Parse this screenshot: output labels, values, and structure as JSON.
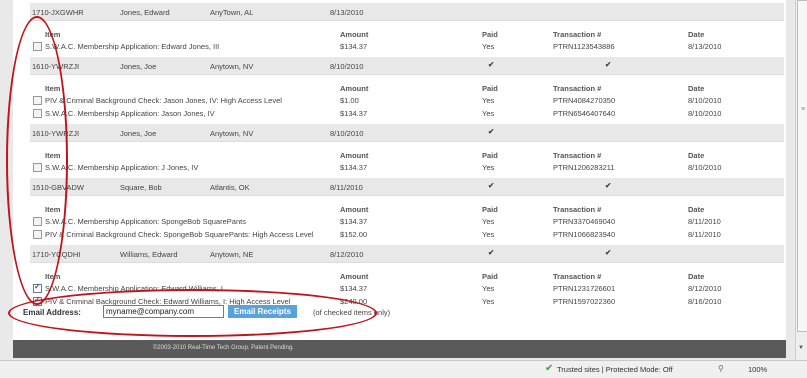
{
  "groups": [
    {
      "id": "1710-JXGWHR",
      "name": "Jones, Edward",
      "location": "AnyTown, AL",
      "date": "8/13/2010",
      "paid_check": "",
      "txn_check": "",
      "header": {
        "item": "Item",
        "amount": "Amount",
        "paid": "Paid",
        "transaction": "Transaction #",
        "date": "Date"
      },
      "items": [
        {
          "item": "S.W.A.C. Membership Application: Edward Jones, III",
          "amount": "$134.37",
          "paid": "Yes",
          "transaction": "PTRN1123543886",
          "date": "8/13/2010",
          "checked": false
        }
      ]
    },
    {
      "id": "1610-YWRZJI",
      "name": "Jones, Joe",
      "location": "Anytown, NV",
      "date": "8/10/2010",
      "paid_check": "✔",
      "txn_check": "✔",
      "header": {
        "item": "Item",
        "amount": "Amount",
        "paid": "Paid",
        "transaction": "Transaction #",
        "date": "Date"
      },
      "items": [
        {
          "item": "PIV & Criminal Background Check: Jason Jones, IV: High Access Level",
          "amount": "$1.00",
          "paid": "Yes",
          "transaction": "PTRN4084270350",
          "date": "8/10/2010",
          "checked": false
        },
        {
          "item": "S.W.A.C. Membership Application: Jason Jones, IV",
          "amount": "$134.37",
          "paid": "Yes",
          "transaction": "PTRN6546407640",
          "date": "8/10/2010",
          "checked": false
        }
      ]
    },
    {
      "id": "1610-YWRZJI",
      "name": "Jones, Joe",
      "location": "Anytown, NV",
      "date": "8/10/2010",
      "paid_check": "✔",
      "txn_check": "",
      "header": {
        "item": "Item",
        "amount": "Amount",
        "paid": "Paid",
        "transaction": "Transaction #",
        "date": "Date"
      },
      "items": [
        {
          "item": "S.W.A.C. Membership Application: J Jones, IV",
          "amount": "$134.37",
          "paid": "Yes",
          "transaction": "PTRN1206283211",
          "date": "8/10/2010",
          "checked": false
        }
      ]
    },
    {
      "id": "1510-GBVADW",
      "name": "Square, Bob",
      "location": "Atlantis, OK",
      "date": "8/11/2010",
      "paid_check": "✔",
      "txn_check": "✔",
      "header": {
        "item": "Item",
        "amount": "Amount",
        "paid": "Paid",
        "transaction": "Transaction #",
        "date": "Date"
      },
      "items": [
        {
          "item": "S.W.A.C. Membership Application: SpongeBob SquarePants",
          "amount": "$134.37",
          "paid": "Yes",
          "transaction": "PTRN3370469040",
          "date": "8/11/2010",
          "checked": false
        },
        {
          "item": "PIV & Criminal Background Check: SpongeBob SquarePants: High Access Level",
          "amount": "$152.00",
          "paid": "Yes",
          "transaction": "PTRN1066823940",
          "date": "8/11/2010",
          "checked": false
        }
      ]
    },
    {
      "id": "1710-YCQDHI",
      "name": "Williams, Edward",
      "location": "Anytown, NE",
      "date": "8/12/2010",
      "paid_check": "✔",
      "txn_check": "✔",
      "header": {
        "item": "Item",
        "amount": "Amount",
        "paid": "Paid",
        "transaction": "Transaction #",
        "date": "Date"
      },
      "items": [
        {
          "item": "S.W.A.C. Membership Application: Edward Williams, I",
          "amount": "$134.37",
          "paid": "Yes",
          "transaction": "PTRN1231726601",
          "date": "8/12/2010",
          "checked": true
        },
        {
          "item": "PIV & Criminal Background Check: Edward Williams, I: High Access Level",
          "amount": "$240.00",
          "paid": "Yes",
          "transaction": "PTRN1597022360",
          "date": "8/16/2010",
          "checked": true
        }
      ]
    }
  ],
  "email": {
    "label": "Email Address:",
    "value": "myname@company.com",
    "button": "Email Receipts",
    "note": "(of checked items only)"
  },
  "footer": {
    "text": "©2003-2010 Real-Time Tech Group. Patent Pending."
  },
  "statusbar": {
    "text": "Trusted sites | Protected Mode: Off",
    "zoom": "100%",
    "check_icon": "✔",
    "security_icon": "⚲"
  },
  "scrollbar": {
    "grip": "≡",
    "down_arrow": "▼"
  },
  "colors": {
    "accent": "#5aa3d9",
    "annotation": "#c0141c",
    "check": "#3b8fd6"
  }
}
